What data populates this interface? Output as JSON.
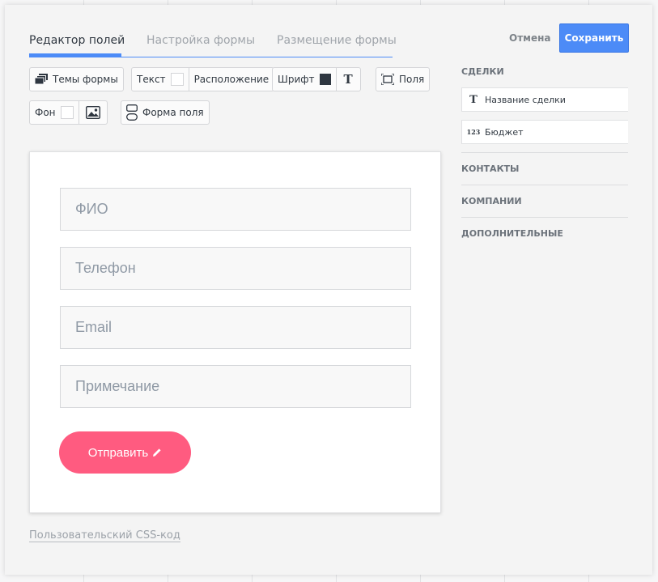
{
  "tabs": [
    {
      "label": "Редактор полей"
    },
    {
      "label": "Настройка формы"
    },
    {
      "label": "Размещение формы"
    }
  ],
  "header": {
    "cancel_label": "Отмена",
    "save_label": "Сохранить"
  },
  "toolbar": {
    "themes_label": "Темы формы",
    "text_label": "Текст",
    "position_label": "Расположение",
    "font_label": "Шрифт",
    "font_bold_glyph": "T",
    "margins_label": "Поля",
    "bg_label": "Фон",
    "field_shape_label": "Форма поля",
    "font_color": "#2e3640"
  },
  "form": {
    "fields": [
      {
        "placeholder": "ФИО"
      },
      {
        "placeholder": "Телефон"
      },
      {
        "placeholder": "Email"
      },
      {
        "placeholder": "Примечание"
      }
    ],
    "submit_label": "Отправить",
    "submit_color": "#ff5b80"
  },
  "css_link": "Пользовательский CSS-код",
  "sidebar": {
    "deals_title": "СДЕЛКИ",
    "deal_fields": [
      {
        "icon": "T",
        "label": "Название сделки"
      },
      {
        "icon": "123",
        "label": "Бюджет"
      }
    ],
    "sections": [
      {
        "label": "КОНТАКТЫ"
      },
      {
        "label": "КОМПАНИИ"
      },
      {
        "label": "ДОПОЛНИТЕЛЬНЫЕ"
      }
    ]
  },
  "accent_color": "#4c8bf7"
}
